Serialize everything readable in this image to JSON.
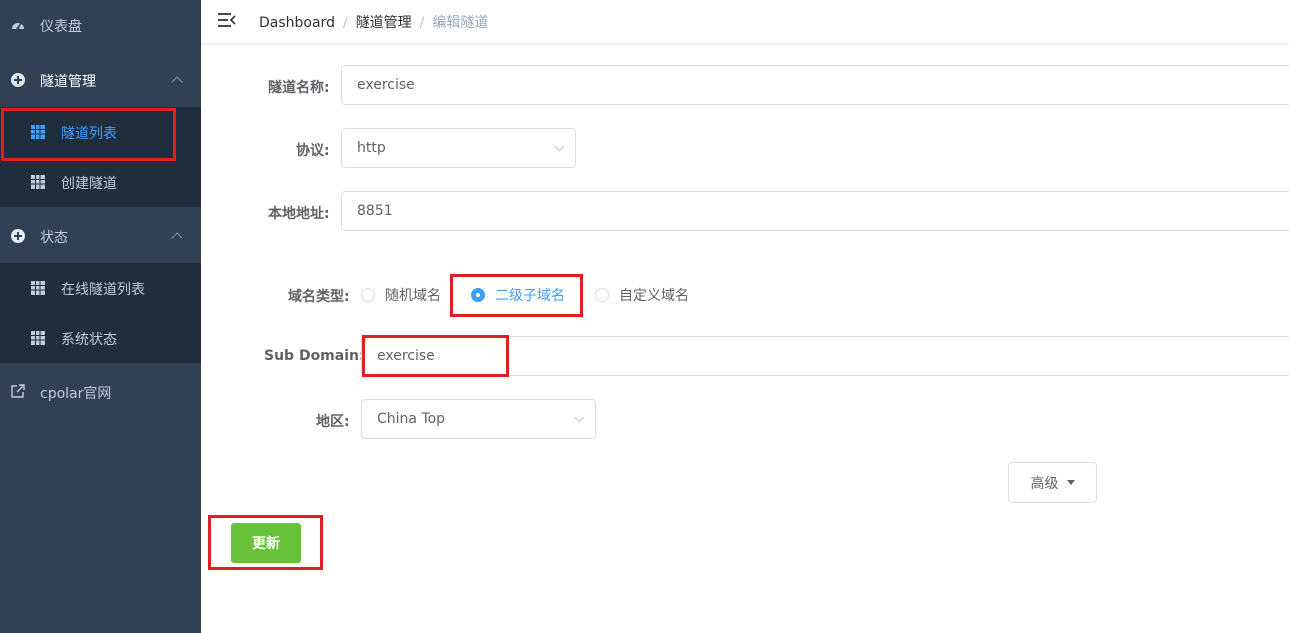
{
  "sidebar": {
    "dashboard": "仪表盘",
    "tunnel_mgmt": "隧道管理",
    "tunnel_list": "隧道列表",
    "create_tunnel": "创建隧道",
    "status": "状态",
    "online_tunnels": "在线隧道列表",
    "system_status": "系统状态",
    "cpolar_site": "cpolar官网"
  },
  "breadcrumb": [
    "Dashboard",
    "隧道管理",
    "编辑隧道"
  ],
  "form": {
    "name_label": "隧道名称:",
    "name_value": "exercise",
    "protocol_label": "协议:",
    "protocol_value": "http",
    "local_label": "本地地址:",
    "local_value": "8851",
    "domain_type_label": "域名类型:",
    "domain_types": [
      "随机域名",
      "二级子域名",
      "自定义域名"
    ],
    "domain_type_selected": "二级子域名",
    "subdomain_label": "Sub Domain:",
    "subdomain_value": "exercise",
    "region_label": "地区:",
    "region_value": "China Top",
    "advanced_button": "高级",
    "update_button": "更新"
  },
  "colors": {
    "sidebar_bg": "#304156",
    "submenu_bg": "#1f2d3d",
    "accent": "#409eff",
    "success": "#67c23a",
    "highlight": "#e02020"
  }
}
